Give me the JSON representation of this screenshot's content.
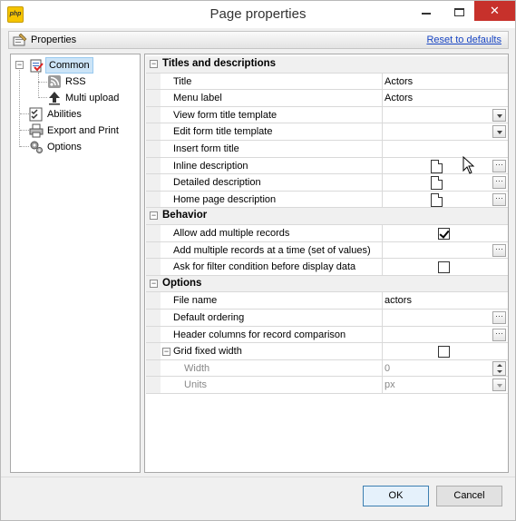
{
  "window": {
    "title": "Page properties",
    "app_icon_text": "php",
    "close_glyph": "✕"
  },
  "header": {
    "label": "Properties",
    "reset_link": "Reset to defaults"
  },
  "tree": {
    "items": [
      {
        "label": "Common",
        "icon": "common-page-icon",
        "selected": true,
        "expander": "−"
      },
      {
        "label": "RSS",
        "icon": "rss-icon"
      },
      {
        "label": "Multi upload",
        "icon": "upload-arrow-icon"
      },
      {
        "label": "Abilities",
        "icon": "checklist-icon"
      },
      {
        "label": "Export and Print",
        "icon": "printer-icon"
      },
      {
        "label": "Options",
        "icon": "gears-icon"
      }
    ]
  },
  "grid": {
    "cat_expander": "−",
    "ellipsis": "···",
    "categories": {
      "titles": "Titles and descriptions",
      "behavior": "Behavior",
      "options": "Options"
    },
    "titles_rows": [
      {
        "name": "Title",
        "value": "Actors"
      },
      {
        "name": "Menu label",
        "value": "Actors"
      },
      {
        "name": "View form title template",
        "value": ""
      },
      {
        "name": "Edit form title template",
        "value": ""
      },
      {
        "name": "Insert form title",
        "value": ""
      },
      {
        "name": "Inline description",
        "value": ""
      },
      {
        "name": "Detailed description",
        "value": ""
      },
      {
        "name": "Home page description",
        "value": ""
      }
    ],
    "behavior_rows": [
      {
        "name": "Allow add multiple records",
        "checked": true
      },
      {
        "name": "Add multiple records at a time (set of values)",
        "value": ""
      },
      {
        "name": "Ask for filter condition before display data",
        "checked": false
      }
    ],
    "options_rows": [
      {
        "name": "File name",
        "value": "actors"
      },
      {
        "name": "Default ordering",
        "value": ""
      },
      {
        "name": "Header columns for record comparison",
        "value": ""
      },
      {
        "name": "Grid fixed width",
        "checked": false,
        "expander": "−"
      },
      {
        "name": "Width",
        "value": "0"
      },
      {
        "name": "Units",
        "value": "px"
      }
    ]
  },
  "buttons": {
    "ok": "OK",
    "cancel": "Cancel"
  }
}
